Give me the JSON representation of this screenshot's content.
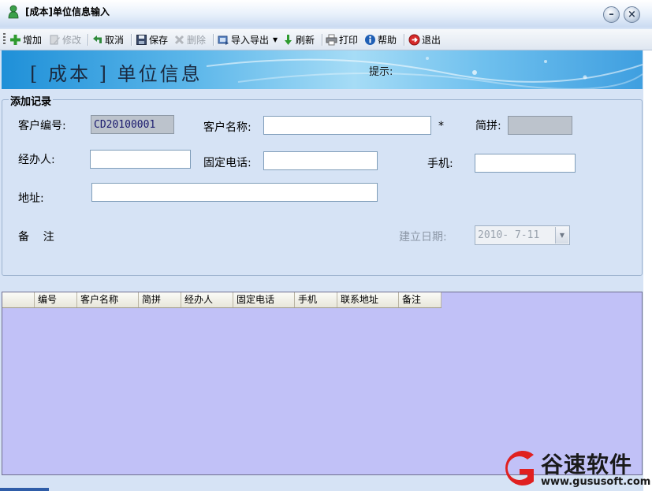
{
  "window": {
    "title": "[成本]单位信息输入"
  },
  "toolbar": {
    "items": [
      {
        "label": "增加",
        "icon": "add-icon",
        "enabled": true
      },
      {
        "label": "修改",
        "icon": "edit-icon",
        "enabled": false
      },
      {
        "label": "取消",
        "icon": "undo-icon",
        "enabled": true
      },
      {
        "label": "保存",
        "icon": "save-icon",
        "enabled": true
      },
      {
        "label": "删除",
        "icon": "delete-icon",
        "enabled": false
      },
      {
        "label": "导入导出",
        "icon": "import-export-icon",
        "enabled": true
      },
      {
        "label": "刷新",
        "icon": "refresh-icon",
        "enabled": true
      },
      {
        "label": "打印",
        "icon": "print-icon",
        "enabled": true
      },
      {
        "label": "帮助",
        "icon": "help-icon",
        "enabled": true
      },
      {
        "label": "退出",
        "icon": "exit-icon",
        "enabled": true
      }
    ]
  },
  "banner": {
    "title": "[ 成本 ] 单位信息",
    "hint_label": "提示:"
  },
  "form": {
    "legend": "添加记录",
    "customer_code_label": "客户编号:",
    "customer_code_value": "CD20100001",
    "customer_name_label": "客户名称:",
    "customer_name_value": "",
    "required_mark": "*",
    "pinyin_label": "简拼:",
    "pinyin_value": "",
    "handler_label": "经办人:",
    "handler_value": "",
    "phone_label": "固定电话:",
    "phone_value": "",
    "mobile_label": "手机:",
    "mobile_value": "",
    "address_label": "地址:",
    "address_value": "",
    "remark_label": "备    注",
    "date_label": "建立日期:",
    "date_value": "2010- 7-11"
  },
  "grid": {
    "columns": [
      "编号",
      "客户名称",
      "简拼",
      "经办人",
      "固定电话",
      "手机",
      "联系地址",
      "备注"
    ]
  },
  "watermark": {
    "name": "谷速软件",
    "url": "www.gususoft.com",
    "logo_color": "#e02020"
  }
}
